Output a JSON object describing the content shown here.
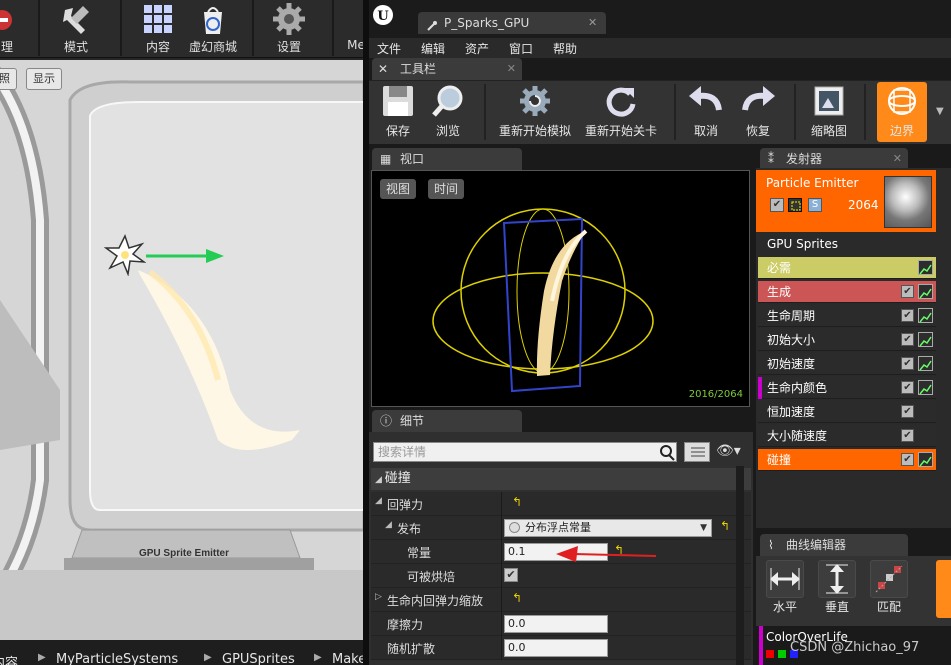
{
  "left_editor": {
    "toolbar": [
      {
        "id": "manage",
        "label": "理"
      },
      {
        "id": "modes",
        "label": "模式"
      },
      {
        "id": "content",
        "label": "内容"
      },
      {
        "id": "marketplace",
        "label": "虚幻商城"
      },
      {
        "id": "settings",
        "label": "设置"
      },
      {
        "id": "more",
        "label": "Me"
      }
    ],
    "viewport_buttons": [
      "照",
      "显示"
    ],
    "emitter_sign": "GPU Sprite Emitter",
    "breadcrumb": [
      "内容",
      "MyParticleSystems",
      "GPUSprites",
      "Make"
    ]
  },
  "cascade": {
    "doc_tab": "P_Sparks_GPU",
    "menu": [
      "文件",
      "编辑",
      "资产",
      "窗口",
      "帮助"
    ],
    "toolbar_tab": "工具栏",
    "toolbar": [
      {
        "id": "save",
        "label": "保存"
      },
      {
        "id": "browse",
        "label": "浏览"
      },
      {
        "id": "restart-sim",
        "label": "重新开始模拟"
      },
      {
        "id": "restart-level",
        "label": "重新开始关卡"
      },
      {
        "id": "undo",
        "label": "取消"
      },
      {
        "id": "redo",
        "label": "恢复"
      },
      {
        "id": "thumbnail",
        "label": "缩略图"
      },
      {
        "id": "bounds",
        "label": "边界"
      }
    ],
    "viewport": {
      "tab": "视口",
      "buttons": [
        "视图",
        "时间"
      ],
      "particle_count": "2016/2064"
    },
    "details": {
      "tab": "细节",
      "search_placeholder": "搜索详情",
      "category": "碰撞",
      "rows": [
        {
          "id": "restitution",
          "label": "回弹力",
          "expand": "▲"
        },
        {
          "id": "distribution",
          "label": "发布",
          "expand": "▲",
          "value": "分布浮点常量"
        },
        {
          "id": "constant",
          "label": "常量",
          "value": "0.1"
        },
        {
          "id": "bakeable",
          "label": "可被烘焙",
          "checked": true
        },
        {
          "id": "restitution-scale",
          "label": "生命内回弹力缩放",
          "expand": "▷"
        },
        {
          "id": "friction",
          "label": "摩擦力",
          "value": "0.0"
        },
        {
          "id": "random-spread",
          "label": "随机扩散",
          "value": "0.0"
        }
      ]
    },
    "emitters": {
      "tab": "发射器",
      "emitter_name": "Particle Emitter",
      "emitter_count": "2064",
      "emitter_badge": "S",
      "type_data": "GPU Sprites",
      "modules": [
        {
          "id": "required",
          "label": "必需",
          "color": "#cccc66",
          "text_color": "#ffffff",
          "checkbox": false,
          "graph": true
        },
        {
          "id": "spawn",
          "label": "生成",
          "color": "#cc5555",
          "checkbox": true,
          "graph": true
        },
        {
          "id": "lifetime",
          "label": "生命周期",
          "color": "#2b2b2b",
          "checkbox": true,
          "graph": true
        },
        {
          "id": "initial-size",
          "label": "初始大小",
          "color": "#2b2b2b",
          "checkbox": true,
          "graph": true
        },
        {
          "id": "initial-velocity",
          "label": "初始速度",
          "color": "#2b2b2b",
          "checkbox": true,
          "graph": true
        },
        {
          "id": "color-over-life",
          "label": "生命内颜色",
          "color": "#2b2b2b",
          "strip": "#cc00cc",
          "checkbox": true,
          "graph": true
        },
        {
          "id": "const-accel",
          "label": "恒加速度",
          "color": "#2b2b2b",
          "checkbox": true,
          "graph": false
        },
        {
          "id": "size-by-speed",
          "label": "大小随速度",
          "color": "#2b2b2b",
          "checkbox": true,
          "graph": false
        },
        {
          "id": "collision",
          "label": "碰撞",
          "color": "#ff6600",
          "checkbox": true,
          "graph": true
        }
      ]
    },
    "curve_editor": {
      "tab": "曲线编辑器",
      "buttons": [
        {
          "id": "horizontal",
          "label": "水平"
        },
        {
          "id": "vertical",
          "label": "垂直"
        },
        {
          "id": "fit",
          "label": "匹配"
        }
      ],
      "curve_name": "ColorOverLife"
    },
    "watermark": "CSDN @Zhichao_97"
  },
  "colors": {
    "accent": "#ff6600",
    "spawn": "#cc5555",
    "required": "#cccc66"
  }
}
